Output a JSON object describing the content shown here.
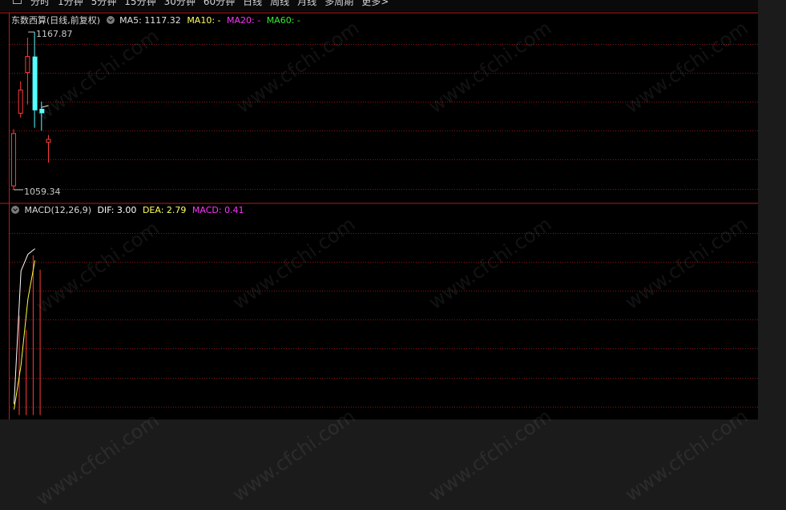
{
  "toolbar": {
    "periods": [
      "分时",
      "1分钟",
      "5分钟",
      "15分钟",
      "30分钟",
      "60分钟",
      "日线",
      "周线",
      "月线",
      "多周期",
      "更多>"
    ]
  },
  "price_panel": {
    "stock_label": "东数西算(日线,前复权)",
    "ma5": "MA5: 1117.32",
    "ma10": "MA10: -",
    "ma20": "MA20: -",
    "ma60": "MA60: -",
    "high_label": "1167.87",
    "low_label": "1059.34"
  },
  "macd_panel": {
    "name": "MACD(12,26,9)",
    "dif": "DIF: 3.00",
    "dea": "DEA: 2.79",
    "macd": "MACD: 0.41"
  },
  "watermark": "www.cfchi.com",
  "colors": {
    "up": "#ff3b3b",
    "down": "#54ffff",
    "dif_line": "#ffffff",
    "dea_line": "#ffff40",
    "macd_label": "#ff33ff",
    "ma20": "#ff33ff",
    "ma60": "#33ee33",
    "ma5": "#e0e0e0",
    "grid": "#8a1616",
    "border": "#b01e1e"
  },
  "chart_data": [
    {
      "type": "candlestick",
      "ylim": [
        1059.34,
        1167.87
      ],
      "candles": [
        {
          "open": 1062,
          "close": 1098,
          "high": 1101,
          "low": 1059.34
        },
        {
          "open": 1112,
          "close": 1128,
          "high": 1134,
          "low": 1109
        },
        {
          "open": 1140,
          "close": 1151,
          "high": 1164,
          "low": 1118
        },
        {
          "open": 1151,
          "close": 1114,
          "high": 1167.87,
          "low": 1102
        },
        {
          "open": 1115,
          "close": 1112,
          "high": 1120,
          "low": 1100
        },
        {
          "open": 1092,
          "close": 1094,
          "high": 1097,
          "low": 1078
        }
      ],
      "ma5_partial": [
        1116,
        1117.32
      ]
    },
    {
      "type": "line",
      "dif": [
        0.2,
        2.6,
        2.9,
        3.0
      ],
      "dea": [
        0.1,
        0.9,
        2.1,
        2.79
      ],
      "macd_hist": [
        0.28,
        0.24,
        0.45,
        0.41
      ]
    }
  ]
}
